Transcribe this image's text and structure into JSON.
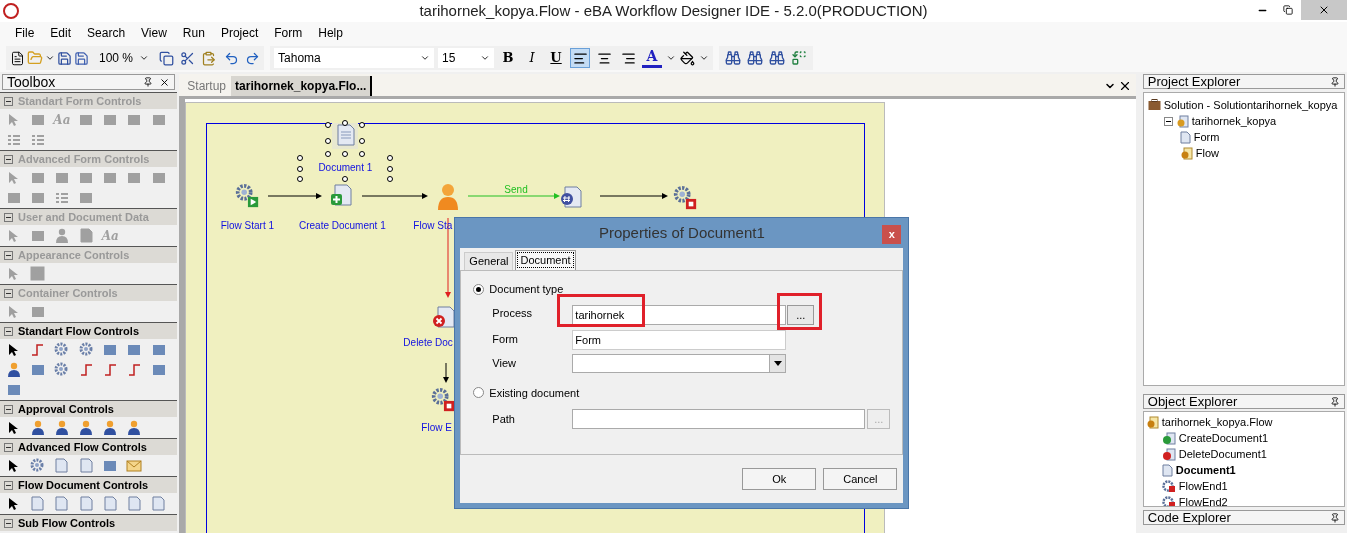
{
  "window": {
    "title": "tarihornek_kopya.Flow - eBA Workflow Designer IDE - 5.2.0(PRODUCTION)"
  },
  "menu": [
    "File",
    "Edit",
    "Search",
    "View",
    "Run",
    "Project",
    "Form",
    "Help"
  ],
  "toolbar": {
    "zoom": "100 %",
    "font": "Tahoma",
    "size": "15",
    "bold": "B",
    "italic": "I",
    "underline": "U",
    "font_color": "A",
    "align": [
      {
        "selected": true
      },
      {
        "selected": false
      },
      {
        "selected": false
      }
    ]
  },
  "toolbox": {
    "title": "Toolbox",
    "sections": [
      {
        "title": "Standart Form Controls",
        "disabled": true,
        "tools": [
          {
            "kind": "pointer"
          },
          {
            "kind": "shape"
          },
          {
            "kind": "text",
            "label": "Aa"
          },
          {
            "kind": "shape"
          },
          {
            "kind": "shape"
          },
          {
            "kind": "shape"
          },
          {
            "kind": "shape"
          },
          {
            "kind": "list"
          },
          {
            "kind": "list"
          }
        ]
      },
      {
        "title": "Advanced Form Controls",
        "disabled": true,
        "tools": [
          {
            "kind": "pointer"
          },
          {
            "kind": "shape"
          },
          {
            "kind": "shape"
          },
          {
            "kind": "shape"
          },
          {
            "kind": "shape"
          },
          {
            "kind": "shape"
          },
          {
            "kind": "shape"
          },
          {
            "kind": "shape"
          },
          {
            "kind": "shape"
          },
          {
            "kind": "list"
          },
          {
            "kind": "shape"
          }
        ]
      },
      {
        "title": "User and Document Data",
        "disabled": true,
        "tools": [
          {
            "kind": "pointer"
          },
          {
            "kind": "shape"
          },
          {
            "kind": "person"
          },
          {
            "kind": "document"
          },
          {
            "kind": "text",
            "label": "Aa"
          }
        ]
      },
      {
        "title": "Appearance Controls",
        "disabled": true,
        "tools": [
          {
            "kind": "pointer"
          },
          {
            "kind": "image"
          }
        ]
      },
      {
        "title": "Container Controls",
        "disabled": true,
        "tools": [
          {
            "kind": "pointer"
          },
          {
            "kind": "shape"
          }
        ]
      },
      {
        "title": "Standart Flow Controls",
        "disabled": false,
        "tools": [
          {
            "kind": "pointer"
          },
          {
            "kind": "connector"
          },
          {
            "kind": "gear"
          },
          {
            "kind": "gear"
          },
          {
            "kind": "shape"
          },
          {
            "kind": "shape"
          },
          {
            "kind": "shape"
          },
          {
            "kind": "person"
          },
          {
            "kind": "shape"
          },
          {
            "kind": "gear"
          },
          {
            "kind": "connector"
          },
          {
            "kind": "connector"
          },
          {
            "kind": "connector"
          },
          {
            "kind": "shape"
          },
          {
            "kind": "shape"
          }
        ]
      },
      {
        "title": "Approval Controls",
        "disabled": false,
        "tools": [
          {
            "kind": "pointer"
          },
          {
            "kind": "person"
          },
          {
            "kind": "person"
          },
          {
            "kind": "person"
          },
          {
            "kind": "person"
          },
          {
            "kind": "person"
          }
        ]
      },
      {
        "title": "Advanced Flow Controls",
        "disabled": false,
        "tools": [
          {
            "kind": "pointer"
          },
          {
            "kind": "gear"
          },
          {
            "kind": "document"
          },
          {
            "kind": "document"
          },
          {
            "kind": "shape"
          },
          {
            "kind": "mail"
          }
        ]
      },
      {
        "title": "Flow Document Controls",
        "disabled": false,
        "tools": [
          {
            "kind": "pointer"
          },
          {
            "kind": "document"
          },
          {
            "kind": "document"
          },
          {
            "kind": "document"
          },
          {
            "kind": "document"
          },
          {
            "kind": "document"
          },
          {
            "kind": "document"
          }
        ]
      },
      {
        "title": "Sub Flow Controls",
        "disabled": false
      }
    ]
  },
  "tabs": [
    {
      "label": "Startup",
      "selected": false
    },
    {
      "label": "tarihornek_kopya.Flo...",
      "selected": true
    }
  ],
  "canvas": {
    "nodes": [
      {
        "label": "Document 1",
        "kind": "document",
        "selected": true
      },
      {
        "label": "Flow Start 1",
        "kind": "start",
        "selected": false
      },
      {
        "label": "Create Document 1",
        "kind": "create",
        "selected": false
      },
      {
        "label": "Flow Sta",
        "kind": "person",
        "selected": false
      },
      {
        "kind": "numbered",
        "selected": false
      },
      {
        "kind": "end",
        "selected": false
      },
      {
        "label": "Delete Doc",
        "kind": "delete",
        "selected": false
      },
      {
        "label": "Flow E",
        "kind": "end",
        "selected": false
      }
    ],
    "edges": [
      {
        "kind": "normal"
      },
      {
        "kind": "normal"
      },
      {
        "kind": "send",
        "label": "Send"
      },
      {
        "kind": "normal"
      },
      {
        "kind": "reject"
      },
      {
        "kind": "normal"
      }
    ]
  },
  "dialog": {
    "title": "Properties of Document1",
    "close": "x",
    "tabs": [
      {
        "label": "General",
        "selected": false
      },
      {
        "label": "Document",
        "selected": true
      }
    ],
    "options": [
      {
        "label": "Document type",
        "selected": true
      },
      {
        "label": "Existing document",
        "selected": false
      }
    ],
    "process": {
      "label": "Process",
      "value": "tarihornek",
      "highlighted": true
    },
    "browse": {
      "label": "...",
      "highlighted": true
    },
    "form": {
      "label": "Form",
      "value": "Form"
    },
    "view": {
      "label": "View"
    },
    "path": {
      "label": "Path"
    },
    "path_browse": {
      "label": "...",
      "disabled": true
    },
    "buttons": [
      "Ok",
      "Cancel"
    ]
  },
  "project_explorer": {
    "title": "Project Explorer",
    "items": [
      {
        "label": "Solution - Solutiontarihornek_kopya",
        "kind": "solution",
        "children": [
          {
            "label": "tarihornek_kopya",
            "kind": "project",
            "expanded": true,
            "children": [
              {
                "label": "Form",
                "kind": "form"
              },
              {
                "label": "Flow",
                "kind": "flow"
              }
            ]
          }
        ]
      }
    ]
  },
  "object_explorer": {
    "title": "Object Explorer",
    "items": [
      {
        "label": "tarihornek_kopya.Flow",
        "kind": "flow",
        "selected": false,
        "children": [
          {
            "label": "CreateDocument1",
            "kind": "create",
            "selected": false
          },
          {
            "label": "DeleteDocument1",
            "kind": "delete",
            "selected": false
          },
          {
            "label": "Document1",
            "kind": "document",
            "selected": true
          },
          {
            "label": "FlowEnd1",
            "kind": "end",
            "selected": false
          },
          {
            "label": "FlowEnd2",
            "kind": "end",
            "selected": false
          }
        ]
      }
    ]
  },
  "code_explorer": {
    "title": "Code Explorer"
  }
}
